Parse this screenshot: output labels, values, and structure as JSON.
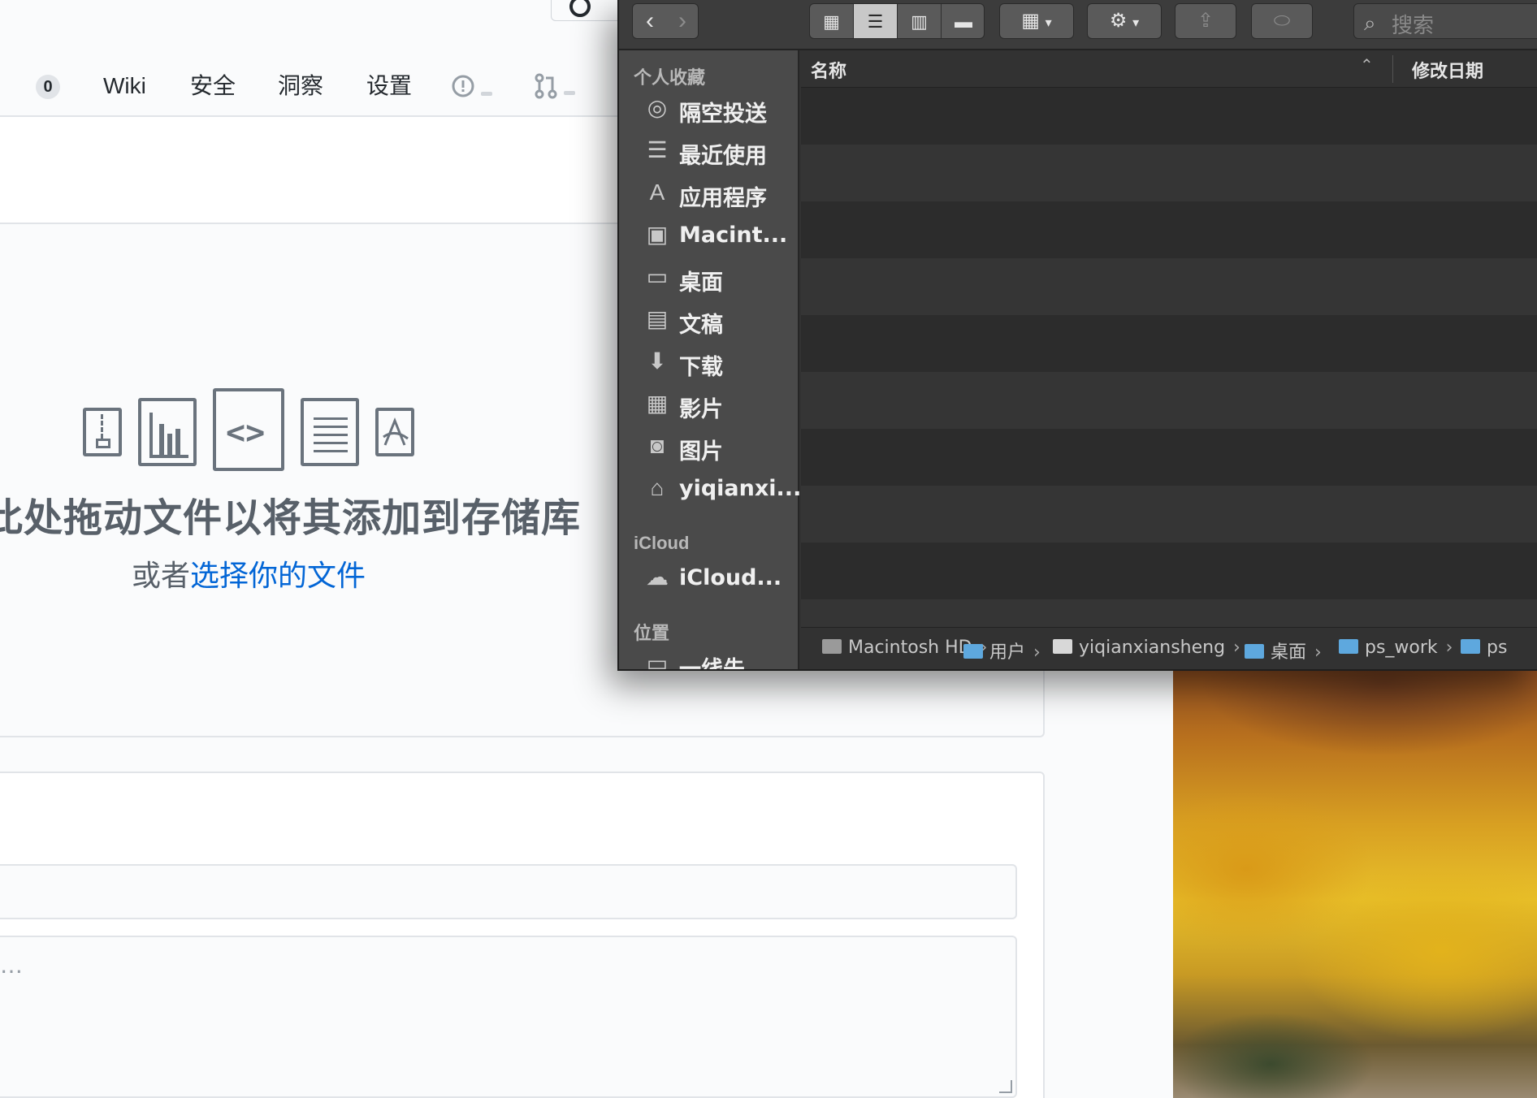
{
  "web": {
    "nav": [
      {
        "label": "Wiki"
      },
      {
        "label": "安全"
      },
      {
        "label": "洞察"
      },
      {
        "label": "设置"
      }
    ],
    "counter": "0",
    "drop_title": "此处拖动文件以将其添加到存储库",
    "drop_sub_prefix": "或者",
    "drop_sub_link": "选择你的文件",
    "textarea_placeholder": "…"
  },
  "finder": {
    "search_placeholder": "搜索",
    "sidebar": {
      "favorites_title": "个人收藏",
      "favorites": [
        {
          "label": "隔空投送",
          "icon": "airdrop-icon",
          "glyph": "◎"
        },
        {
          "label": "最近使用",
          "icon": "recents-icon",
          "glyph": "☰"
        },
        {
          "label": "应用程序",
          "icon": "applications-icon",
          "glyph": "A"
        },
        {
          "label": "Macint...",
          "icon": "hard-drive-icon",
          "glyph": "▣"
        },
        {
          "label": "桌面",
          "icon": "desktop-icon",
          "glyph": "▭"
        },
        {
          "label": "文稿",
          "icon": "documents-icon",
          "glyph": "▤"
        },
        {
          "label": "下载",
          "icon": "downloads-icon",
          "glyph": "⬇"
        },
        {
          "label": "影片",
          "icon": "movies-icon",
          "glyph": "▦"
        },
        {
          "label": "图片",
          "icon": "pictures-icon",
          "glyph": "◙"
        },
        {
          "label": "yiqianxi...",
          "icon": "home-icon",
          "glyph": "⌂"
        }
      ],
      "icloud_title": "iCloud",
      "icloud": [
        {
          "label": "iCloud...",
          "icon": "icloud-drive-icon",
          "glyph": "☁"
        }
      ],
      "locations_title": "位置",
      "locations": [
        {
          "label": "一线先",
          "icon": "computer-icon",
          "glyph": "▭"
        }
      ]
    },
    "columns": {
      "name": "名称",
      "modified": "修改日期"
    },
    "path": [
      "Macintosh HD",
      "用户",
      "yiqianxiansheng",
      "桌面",
      "ps_work",
      "ps"
    ]
  }
}
